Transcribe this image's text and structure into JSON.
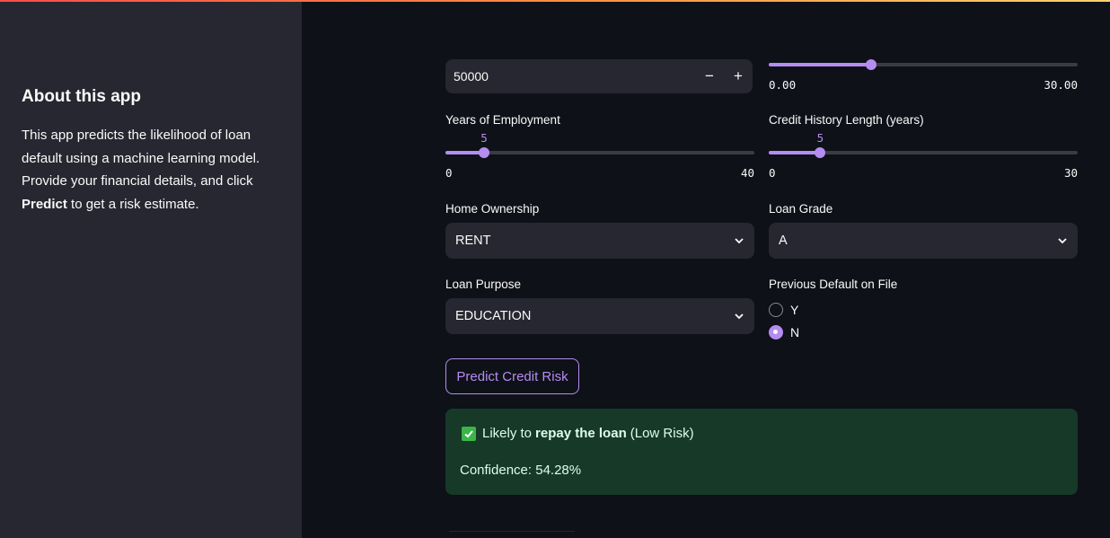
{
  "sidebar": {
    "title": "About this app",
    "desc_part1": "This app predicts the likelihood of loan default using a machine learning model. Provide your financial details, and click ",
    "desc_bold": "Predict",
    "desc_part2": " to get a risk estimate."
  },
  "income_input": {
    "value": "50000",
    "minus": "−",
    "plus": "+"
  },
  "top_slider": {
    "min": "0.00",
    "max": "30.00",
    "fraction": 0.33
  },
  "years_employment": {
    "label": "Years of Employment",
    "value": "5",
    "min": "0",
    "max": "40",
    "fraction": 0.125
  },
  "credit_history": {
    "label": "Credit History Length (years)",
    "value": "5",
    "min": "0",
    "max": "30",
    "fraction": 0.1667
  },
  "home_ownership": {
    "label": "Home Ownership",
    "value": "RENT"
  },
  "loan_grade": {
    "label": "Loan Grade",
    "value": "A"
  },
  "loan_purpose": {
    "label": "Loan Purpose",
    "value": "EDUCATION"
  },
  "previous_default": {
    "label": "Previous Default on File",
    "options": [
      "Y",
      "N"
    ],
    "selected": "N"
  },
  "predict_button": {
    "label": "Predict Credit Risk"
  },
  "result": {
    "prefix": "Likely to",
    "bold": "repay the loan",
    "suffix": "(Low Risk)",
    "confidence": "Confidence: 54.28%"
  },
  "colors": {
    "accent": "#b48cf2",
    "success_bg": "#173928",
    "sidebar_bg": "#262730",
    "main_bg": "#0e1117"
  }
}
